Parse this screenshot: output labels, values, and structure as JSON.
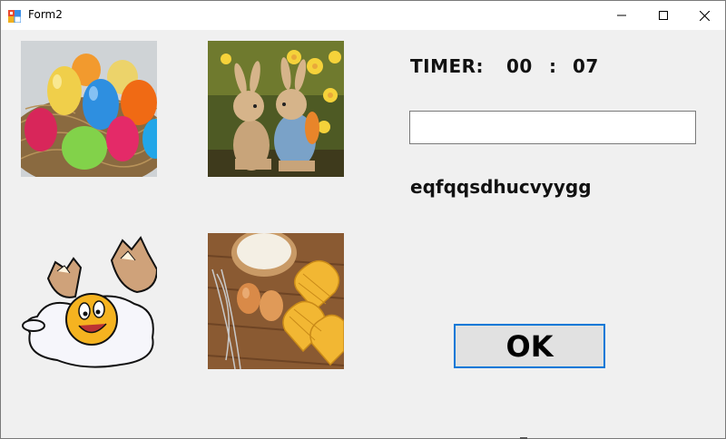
{
  "window": {
    "title": "Form2",
    "icon": "winforms-app-icon",
    "controls": [
      "minimize-icon",
      "maximize-icon",
      "close-icon"
    ]
  },
  "images": [
    {
      "name": "easter-eggs-in-nest-image"
    },
    {
      "name": "bunny-figurines-image"
    },
    {
      "name": "cartoon-cracked-egg-image"
    },
    {
      "name": "eggs-flour-waffles-image"
    }
  ],
  "timer": {
    "label": "TIMER:",
    "minutes": "00",
    "separator": ":",
    "seconds": "07"
  },
  "input": {
    "value": ""
  },
  "code_text": "eqfqqsdhucvyygg",
  "ok_button": {
    "label": "OK"
  },
  "colors": {
    "accent_focus": "#0078d7",
    "form_bg": "#f0f0f0"
  }
}
